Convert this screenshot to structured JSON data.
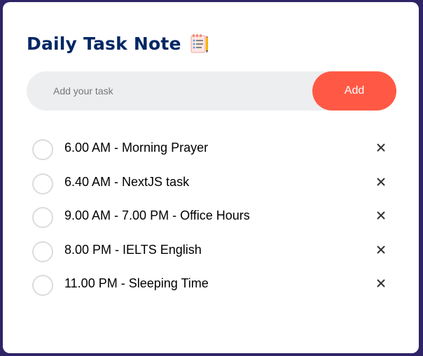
{
  "header": {
    "title": "Daily Task Note",
    "icon": "notepad-icon"
  },
  "input": {
    "placeholder": "Add your task",
    "value": ""
  },
  "add_button": {
    "label": "Add"
  },
  "tasks": [
    {
      "text": "6.00 AM - Morning Prayer",
      "done": false
    },
    {
      "text": "6.40 AM - NextJS task",
      "done": false
    },
    {
      "text": "9.00 AM - 7.00 PM - Office Hours",
      "done": false
    },
    {
      "text": "8.00 PM - IELTS English",
      "done": false
    },
    {
      "text": "11.00 PM - Sleeping Time",
      "done": false
    }
  ],
  "colors": {
    "background": "#2e2466",
    "title": "#002765",
    "accent": "#ff5945",
    "input_bg": "#edeef0",
    "circle_border": "#dcdcdc"
  }
}
